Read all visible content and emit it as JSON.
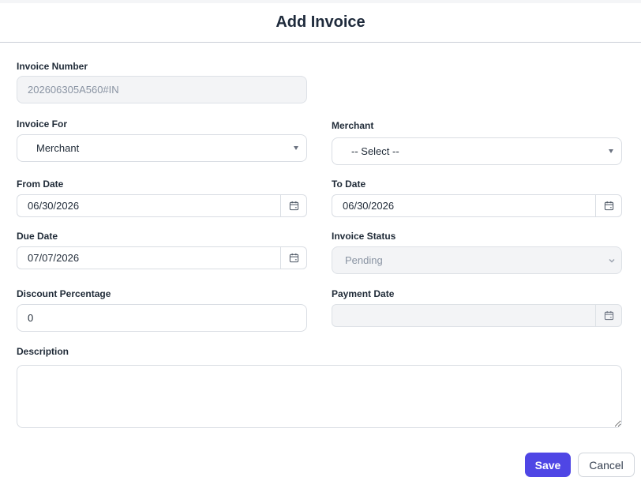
{
  "modal": {
    "title": "Add Invoice"
  },
  "fields": {
    "invoice_number": {
      "label": "Invoice Number",
      "value": "202606305A560#IN"
    },
    "invoice_for": {
      "label": "Invoice For",
      "value": "Merchant"
    },
    "merchant": {
      "label": "Merchant",
      "value": "-- Select --"
    },
    "from_date": {
      "label": "From Date",
      "value": "06/30/2026"
    },
    "to_date": {
      "label": "To Date",
      "value": "06/30/2026"
    },
    "due_date": {
      "label": "Due Date",
      "value": "07/07/2026"
    },
    "invoice_status": {
      "label": "Invoice Status",
      "value": "Pending"
    },
    "discount_percentage": {
      "label": "Discount Percentage",
      "value": "0"
    },
    "payment_date": {
      "label": "Payment Date",
      "value": ""
    },
    "description": {
      "label": "Description",
      "value": ""
    }
  },
  "buttons": {
    "save": "Save",
    "cancel": "Cancel"
  },
  "colors": {
    "primary": "#4f46e5",
    "border": "#d9dde3",
    "disabled_bg": "#f3f4f6"
  }
}
